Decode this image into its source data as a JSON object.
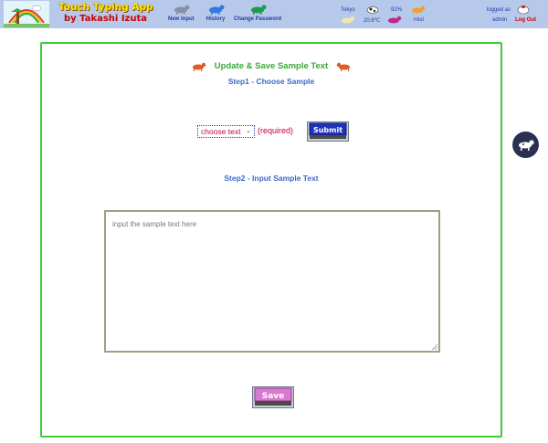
{
  "header": {
    "logo_title": "Touch Typing App",
    "logo_subtitle": "by Takashi Izuta",
    "nav": [
      {
        "label": "New Input",
        "icon": "dog-icon"
      },
      {
        "label": "History",
        "icon": "dog-icon"
      },
      {
        "label": "Change Password",
        "icon": "dog-icon"
      }
    ],
    "weather": {
      "city": "Tokyo",
      "temperature": "20.6℃",
      "humidity": "92%",
      "condition": "mist"
    },
    "user": {
      "logged_as": "logged as",
      "name": "admin",
      "logout": "Log Out"
    }
  },
  "main": {
    "title": "Update & Save Sample Text",
    "step1": "Step1 - Choose Sample",
    "select_value": "choose text",
    "required": "(required)",
    "submit_label": "Submit",
    "step2": "Step2 - Input Sample Text",
    "textarea_placeholder": "input the sample text here",
    "save_label": "Save"
  },
  "colors": {
    "header_bg": "#b6c9ea",
    "frame_border": "#3ccd3c",
    "title_green": "#3aa83a",
    "step_blue": "#3b67c9",
    "required_red": "#c3003a"
  }
}
